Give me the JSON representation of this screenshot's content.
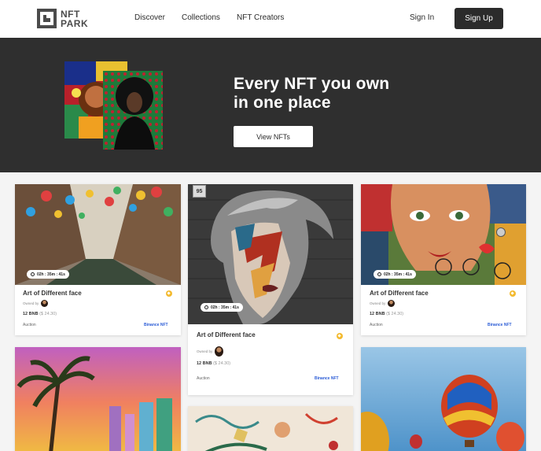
{
  "nav": {
    "logo_line1": "NFT",
    "logo_line2": "PARK",
    "links": [
      "Discover",
      "Collections",
      "NFT Creators"
    ],
    "signin": "Sign In",
    "signup": "Sign Up"
  },
  "hero": {
    "title_line1": "Every NFT you own",
    "title_line2": "in one place",
    "button": "View NFTs"
  },
  "cards": [
    {
      "title": "Art of Different face",
      "owned_by": "Owned by",
      "price": "12 BNB",
      "price_usd": "($ 24.30)",
      "type": "Auction",
      "network": "Binance NFT",
      "timer": "02h : 35m : 41s"
    },
    {
      "title": "Art of Different face",
      "owned_by": "Owned by",
      "price": "12 BNB",
      "price_usd": "($ 24.30)",
      "type": "Auction",
      "network": "Binance NFT",
      "timer": "02h : 35m : 41s",
      "tag": "95"
    },
    {
      "title": "Art of Different face",
      "owned_by": "Owned by",
      "price": "12 BNB",
      "price_usd": "($ 24.30)",
      "type": "Auction",
      "network": "Binance NFT",
      "timer": "02h : 35m : 41s"
    }
  ],
  "colors": {
    "dark": "#2f2f2f",
    "accent_link": "#2b5cd6",
    "bnb": "#f3ba2f"
  }
}
